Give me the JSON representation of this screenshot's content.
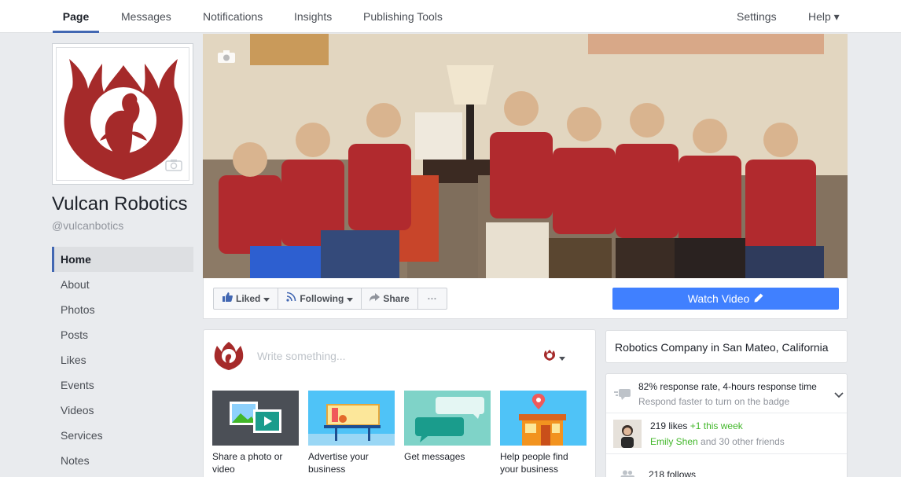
{
  "topnav": {
    "tabs": [
      "Page",
      "Messages",
      "Notifications",
      "Insights",
      "Publishing Tools"
    ],
    "settings": "Settings",
    "help": "Help ▾"
  },
  "page": {
    "name": "Vulcan Robotics",
    "handle": "@vulcanbotics"
  },
  "leftnav": [
    "Home",
    "About",
    "Photos",
    "Posts",
    "Likes",
    "Events",
    "Videos",
    "Services",
    "Notes"
  ],
  "actions": {
    "liked": "Liked",
    "following": "Following",
    "share": "Share",
    "more": "···",
    "watch": "Watch Video"
  },
  "composer": {
    "placeholder": "Write something...",
    "tiles": [
      "Share a photo or video",
      "Advertise your business",
      "Get messages",
      "Help people find your business"
    ]
  },
  "about": {
    "category": "Robotics Company in San Mateo, California",
    "response": "82% response rate, 4-hours response time",
    "response_sub": "Respond faster to turn on the badge",
    "likes": "219 likes",
    "likes_week": "+1 this week",
    "friend": "Emily Shen",
    "friends_rest": " and 30 other friends",
    "follows": "218 follows"
  },
  "colors": {
    "brand": "#4267b2",
    "accent": "#4080ff",
    "phoenix": "#a52a2a"
  }
}
